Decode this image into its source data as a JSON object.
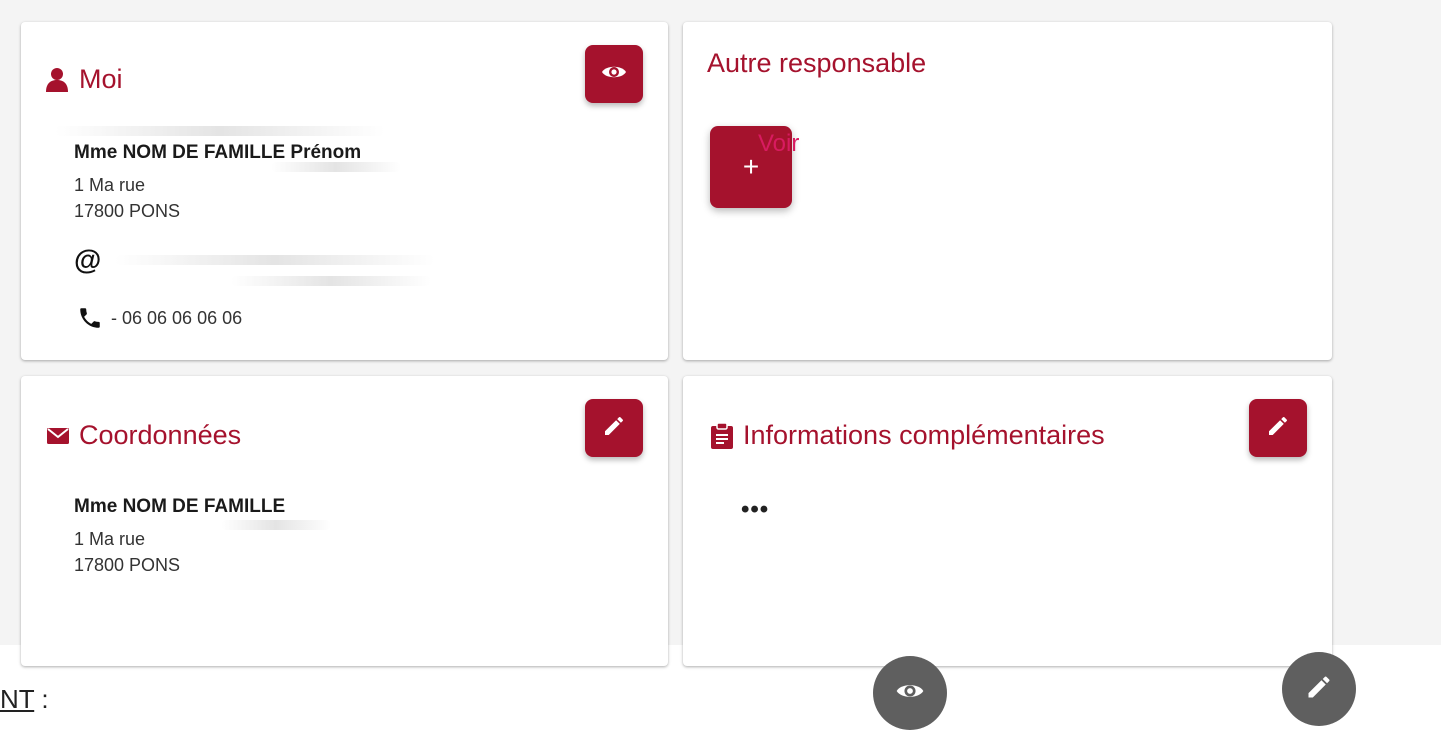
{
  "cards": {
    "moi": {
      "title": "Moi",
      "name": "Mme NOM DE FAMILLE Prénom",
      "address_line1": "1 Ma rue",
      "address_line2": "17800 PONS",
      "phone": "- 06 06 06 06 06"
    },
    "autre": {
      "title": "Autre responsable",
      "add_label": "+",
      "voir_label": "Voir"
    },
    "coordonnees": {
      "title": "Coordonnées",
      "name": "Mme NOM DE FAMILLE",
      "address_line1": "1 Ma rue",
      "address_line2": "17800 PONS"
    },
    "infos": {
      "title": "Informations complémentaires",
      "content": "•••"
    }
  },
  "footer": {
    "note_underlined": "NT",
    "note_suffix": " :"
  },
  "icons": {
    "moi_title": "person-icon",
    "moi_action": "eye-icon",
    "email": "at-icon",
    "phone": "phone-icon",
    "coord_title": "envelope-icon",
    "coord_action": "pencil-icon",
    "infos_title": "clipboard-icon",
    "infos_action": "pencil-icon",
    "legend_view": "eye-icon",
    "legend_edit": "pencil-icon"
  },
  "colors": {
    "accent": "#a5122d",
    "voir": "#d81b60",
    "legend_button": "#5f5f5f"
  }
}
